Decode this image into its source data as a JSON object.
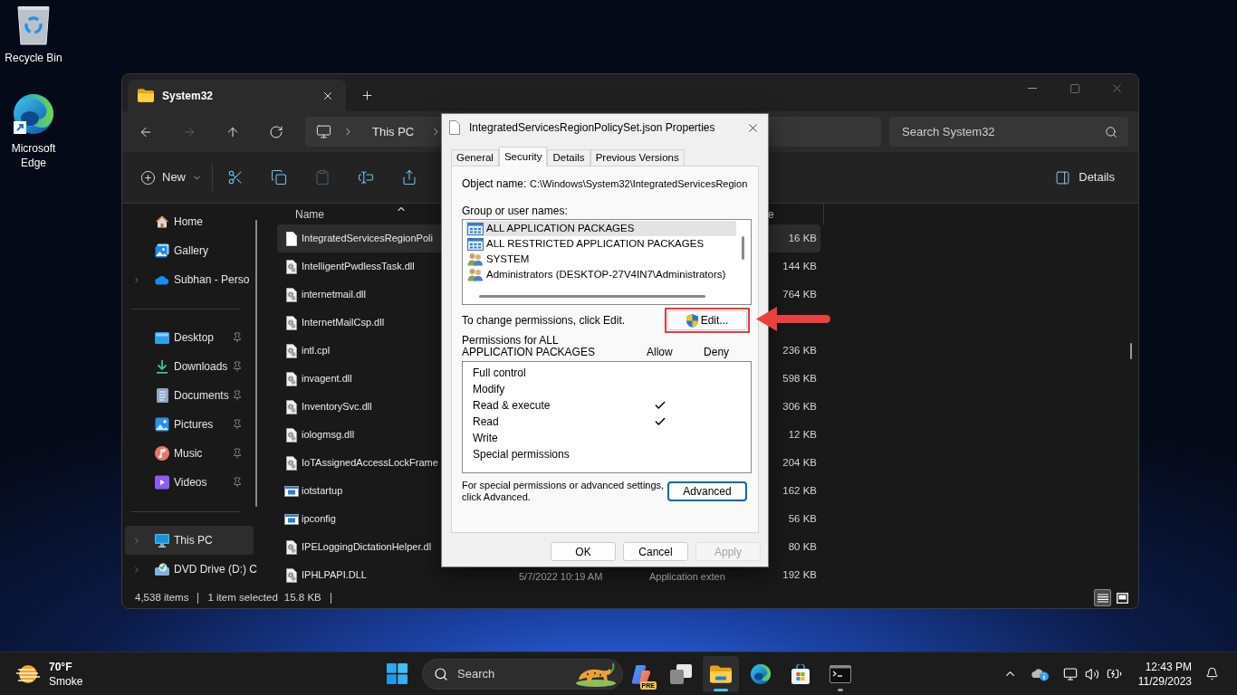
{
  "desktop_icons": [
    {
      "label": "Recycle Bin",
      "kind": "recycle_bin"
    },
    {
      "label": "Microsoft Edge",
      "kind": "edge"
    }
  ],
  "explorer": {
    "tabs": [
      {
        "label": "System32",
        "selected": true
      }
    ],
    "nav_buttons": [
      {
        "kind": "back",
        "disabled": false
      },
      {
        "kind": "forward",
        "disabled": true
      },
      {
        "kind": "up",
        "disabled": false
      },
      {
        "kind": "refresh",
        "disabled": false
      }
    ],
    "address": {
      "segments": [
        "This PC"
      ]
    },
    "search": {
      "placeholder": "Search System32"
    },
    "commands": {
      "new": "New",
      "details": "Details",
      "tools": [
        {
          "kind": "cut",
          "disabled": false
        },
        {
          "kind": "copy",
          "disabled": false
        },
        {
          "kind": "paste",
          "disabled": true
        },
        {
          "kind": "rename",
          "disabled": false
        },
        {
          "kind": "share",
          "disabled": false
        }
      ]
    },
    "nav": [
      [
        {
          "label": "Home",
          "kind": "home",
          "pinned": false,
          "expandable": false,
          "selected": false
        },
        {
          "label": "Gallery",
          "kind": "gallery",
          "pinned": false,
          "expandable": false,
          "selected": false
        },
        {
          "label": "Subhan - Perso",
          "kind": "onedrive",
          "pinned": false,
          "expandable": true,
          "selected": false
        }
      ],
      [
        {
          "label": "Desktop",
          "kind": "desktop",
          "pinned": true,
          "expandable": false,
          "selected": false
        },
        {
          "label": "Downloads",
          "kind": "downloads",
          "pinned": true,
          "expandable": false,
          "selected": false
        },
        {
          "label": "Documents",
          "kind": "documents",
          "pinned": true,
          "expandable": false,
          "selected": false
        },
        {
          "label": "Pictures",
          "kind": "pictures",
          "pinned": true,
          "expandable": false,
          "selected": false
        },
        {
          "label": "Music",
          "kind": "music",
          "pinned": true,
          "expandable": false,
          "selected": false
        },
        {
          "label": "Videos",
          "kind": "videos",
          "pinned": true,
          "expandable": false,
          "selected": false
        }
      ],
      [
        {
          "label": "This PC",
          "kind": "this_pc",
          "pinned": false,
          "expandable": true,
          "selected": true
        },
        {
          "label": "DVD Drive (D:) C",
          "kind": "dvd",
          "pinned": false,
          "expandable": true,
          "selected": false
        }
      ]
    ],
    "columns": [
      {
        "label": "Name",
        "sorted": true
      },
      {
        "label": "e",
        "sorted": false
      }
    ],
    "files": [
      {
        "name": "IntegratedServicesRegionPoli",
        "kind": "json",
        "size": "16 KB",
        "selected": true
      },
      {
        "name": "IntelligentPwdlessTask.dll",
        "kind": "dll",
        "size": "144 KB",
        "selected": false
      },
      {
        "name": "internetmail.dll",
        "kind": "dll",
        "size": "764 KB",
        "selected": false
      },
      {
        "name": "InternetMailCsp.dll",
        "kind": "dll",
        "selected": false
      },
      {
        "name": "intl.cpl",
        "kind": "dll",
        "size": "236 KB",
        "selected": false
      },
      {
        "name": "invagent.dll",
        "kind": "dll",
        "size": "598 KB",
        "selected": false
      },
      {
        "name": "InventorySvc.dll",
        "kind": "dll",
        "size": "306 KB",
        "selected": false
      },
      {
        "name": "iologmsg.dll",
        "kind": "dll",
        "size": "12 KB",
        "selected": false
      },
      {
        "name": "IoTAssignedAccessLockFrame",
        "kind": "dll",
        "size": "204 KB",
        "selected": false
      },
      {
        "name": "iotstartup",
        "kind": "exe",
        "size": "162 KB",
        "selected": false
      },
      {
        "name": "ipconfig",
        "kind": "exe",
        "size": "56 KB",
        "selected": false
      },
      {
        "name": "IPELoggingDictationHelper.dl",
        "kind": "dll",
        "size": "80 KB",
        "selected": false
      },
      {
        "name": "IPHLPAPI.DLL",
        "kind": "dll",
        "size": "192 KB",
        "date": "5/7/2022 10:19 AM",
        "type": "Application exten",
        "selected": false
      }
    ],
    "status": {
      "count": "4,538 items",
      "selection": "1 item selected",
      "size": "15.8 KB"
    },
    "views": [
      {
        "kind": "details",
        "selected": true
      },
      {
        "kind": "tiles",
        "selected": false
      }
    ]
  },
  "dialog": {
    "title": "IntegratedServicesRegionPolicySet.json Properties",
    "tabs": [
      {
        "label": "General",
        "selected": false
      },
      {
        "label": "Security",
        "selected": true
      },
      {
        "label": "Details",
        "selected": false
      },
      {
        "label": "Previous Versions",
        "selected": false
      }
    ],
    "object_label": "Object name:",
    "object_value": "C:\\Windows\\System32\\IntegratedServicesRegion",
    "groups_label": "Group or user names:",
    "groups": [
      {
        "name": "ALL APPLICATION PACKAGES",
        "kind": "package",
        "selected": true
      },
      {
        "name": "ALL RESTRICTED APPLICATION PACKAGES",
        "kind": "package",
        "selected": false
      },
      {
        "name": "SYSTEM",
        "kind": "users",
        "selected": false
      },
      {
        "name": "Administrators (DESKTOP-27V4IN7\\Administrators)",
        "kind": "users",
        "selected": false
      }
    ],
    "change_hint": "To change permissions, click Edit.",
    "edit_button": "Edit...",
    "edit_highlighted": true,
    "permissions_label": "Permissions for ALL APPLICATION PACKAGES",
    "allow_label": "Allow",
    "deny_label": "Deny",
    "permissions": [
      {
        "name": "Full control",
        "allow": false,
        "deny": false
      },
      {
        "name": "Modify",
        "allow": false,
        "deny": false
      },
      {
        "name": "Read & execute",
        "allow": true,
        "deny": false
      },
      {
        "name": "Read",
        "allow": true,
        "deny": false
      },
      {
        "name": "Write",
        "allow": false,
        "deny": false
      },
      {
        "name": "Special permissions",
        "allow": false,
        "deny": false
      }
    ],
    "advanced_hint": "For special permissions or advanced settings, click Advanced.",
    "advanced_button": "Advanced",
    "buttons": [
      {
        "label": "OK",
        "disabled": false
      },
      {
        "label": "Cancel",
        "disabled": false
      },
      {
        "label": "Apply",
        "disabled": true
      }
    ]
  },
  "taskbar": {
    "weather": {
      "temperature": "70°F",
      "condition": "Smoke"
    },
    "search": {
      "label": "Search"
    },
    "apps": [
      {
        "kind": "copilot",
        "badge": "PRE",
        "open": false,
        "focused": false
      },
      {
        "kind": "task_view",
        "open": false,
        "focused": false
      },
      {
        "kind": "file_explorer",
        "open": true,
        "focused": true
      },
      {
        "kind": "edge",
        "open": false,
        "focused": false
      },
      {
        "kind": "store",
        "open": false,
        "focused": false
      },
      {
        "kind": "terminal",
        "open": true,
        "focused": false
      }
    ],
    "clock": {
      "time": "12:43 PM",
      "date": "11/29/2023"
    }
  }
}
